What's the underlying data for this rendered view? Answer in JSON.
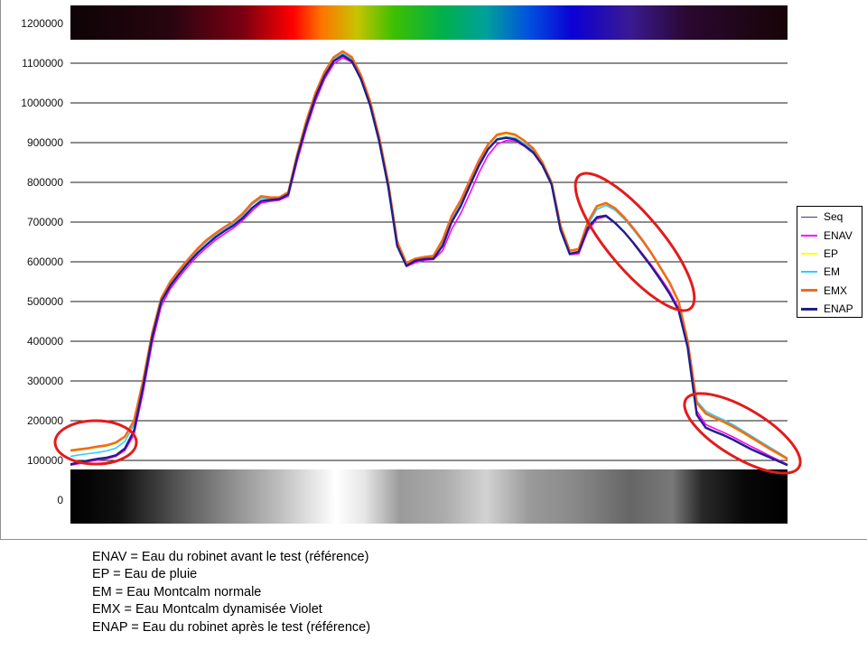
{
  "chart_data": {
    "type": "line",
    "title": "",
    "xlabel": "",
    "ylabel": "",
    "ylim": [
      0,
      1200000
    ],
    "yticks": [
      "0",
      "100000",
      "200000",
      "300000",
      "400000",
      "500000",
      "600000",
      "700000",
      "800000",
      "900000",
      "1000000",
      "1100000",
      "1200000"
    ],
    "grid": true,
    "legend": "right",
    "series": [
      {
        "name": "Seq",
        "color": "#3b3b8f",
        "values": [
          92000,
          96000,
          101000,
          105000,
          108000,
          114000,
          132000,
          178000,
          290000,
          412000,
          502000,
          542000,
          572000,
          600000,
          624000,
          645000,
          664000,
          680000,
          694000,
          713000,
          737000,
          754000,
          757000,
          759000,
          772000,
          868000,
          948000,
          1017000,
          1070000,
          1107000,
          1121000,
          1106000,
          1062000,
          997000,
          908000,
          793000,
          645000,
          592000,
          604000,
          608000,
          609000,
          642000,
          702000,
          742000,
          794000,
          844000,
          885000,
          910000,
          914000,
          910000,
          895000,
          877000,
          845000,
          797000,
          683000,
          622000,
          627000,
          688000,
          714000,
          718000,
          700000,
          677000,
          650000,
          620000,
          590000,
          557000,
          522000,
          480000,
          390000,
          218000,
          184000,
          174000,
          165000,
          154000,
          142000,
          130000,
          120000,
          110000,
          100000,
          90000
        ]
      },
      {
        "name": "ENAV",
        "color": "#ff00ff",
        "values": [
          88000,
          92000,
          97000,
          101000,
          104000,
          110000,
          125000,
          165000,
          270000,
          395000,
          488000,
          532000,
          562000,
          590000,
          615000,
          636000,
          655000,
          671000,
          686000,
          705000,
          728000,
          748000,
          752000,
          755000,
          765000,
          855000,
          935000,
          1005000,
          1060000,
          1098000,
          1114000,
          1102000,
          1062000,
          1000000,
          912000,
          800000,
          655000,
          588000,
          598000,
          604000,
          606000,
          628000,
          682000,
          722000,
          772000,
          824000,
          868000,
          896000,
          905000,
          904000,
          891000,
          873000,
          842000,
          796000,
          684000,
          618000,
          620000,
          678000,
          708000,
          714000,
          697000,
          676000,
          650000,
          621000,
          592000,
          560000,
          526000,
          484000,
          395000,
          225000,
          190000,
          180000,
          170000,
          159000,
          147000,
          135000,
          124000,
          112000,
          101000,
          90000
        ]
      },
      {
        "name": "EP",
        "color": "#ffff00",
        "values": [
          123000,
          126000,
          129000,
          133000,
          136000,
          143000,
          158000,
          197000,
          297000,
          417000,
          506000,
          548000,
          578000,
          605000,
          631000,
          653000,
          670000,
          686000,
          700000,
          720000,
          746000,
          763000,
          760000,
          760000,
          773000,
          870000,
          952000,
          1022000,
          1076000,
          1113000,
          1128000,
          1113000,
          1068000,
          1003000,
          913000,
          798000,
          648000,
          595000,
          606000,
          610000,
          613000,
          652000,
          712000,
          752000,
          802000,
          852000,
          892000,
          917000,
          922000,
          917000,
          903000,
          883000,
          848000,
          798000,
          688000,
          626000,
          630000,
          697000,
          737000,
          745000,
          733000,
          710000,
          683000,
          653000,
          620000,
          583000,
          546000,
          498000,
          398000,
          243000,
          216000,
          205000,
          195000,
          183000,
          170000,
          156000,
          142000,
          128000,
          115000,
          102000
        ]
      },
      {
        "name": "EM",
        "color": "#33ccff",
        "values": [
          110000,
          114000,
          117000,
          120000,
          124000,
          131000,
          148000,
          190000,
          292000,
          414000,
          504000,
          546000,
          576000,
          603000,
          629000,
          651000,
          668000,
          684000,
          698000,
          718000,
          744000,
          760000,
          758000,
          758000,
          770000,
          866000,
          948000,
          1018000,
          1072000,
          1110000,
          1124000,
          1110000,
          1066000,
          1002000,
          912000,
          798000,
          650000,
          594000,
          604000,
          609000,
          611000,
          648000,
          706000,
          746000,
          796000,
          846000,
          886000,
          910000,
          915000,
          912000,
          898000,
          879000,
          846000,
          798000,
          688000,
          622000,
          626000,
          692000,
          732000,
          742000,
          730000,
          708000,
          681000,
          652000,
          620000,
          584000,
          548000,
          502000,
          405000,
          250000,
          224000,
          212000,
          202000,
          190000,
          176000,
          162000,
          148000,
          134000,
          120000,
          106000
        ]
      },
      {
        "name": "EMX",
        "color": "#f26a1b",
        "values": [
          125000,
          128000,
          131000,
          135000,
          138000,
          145000,
          160000,
          200000,
          300000,
          420000,
          508000,
          550000,
          580000,
          607000,
          633000,
          655000,
          672000,
          688000,
          702000,
          722000,
          748000,
          765000,
          762000,
          762000,
          775000,
          872000,
          955000,
          1025000,
          1078000,
          1115000,
          1130000,
          1115000,
          1070000,
          1005000,
          915000,
          800000,
          650000,
          597000,
          608000,
          612000,
          615000,
          655000,
          715000,
          755000,
          805000,
          855000,
          895000,
          920000,
          925000,
          920000,
          905000,
          885000,
          850000,
          800000,
          690000,
          628000,
          632000,
          700000,
          740000,
          748000,
          735000,
          712000,
          685000,
          655000,
          622000,
          585000,
          548000,
          500000,
          400000,
          245000,
          218000,
          207000,
          197000,
          185000,
          172000,
          158000,
          144000,
          130000,
          117000,
          104000
        ]
      },
      {
        "name": "ENAP",
        "color": "#1f1f8c",
        "values": [
          90000,
          95000,
          100000,
          104000,
          107000,
          113000,
          130000,
          175000,
          285000,
          410000,
          500000,
          540000,
          570000,
          598000,
          622000,
          643000,
          662000,
          678000,
          692000,
          711000,
          735000,
          753000,
          756000,
          758000,
          770000,
          865000,
          945000,
          1015000,
          1068000,
          1105000,
          1120000,
          1105000,
          1060000,
          995000,
          905000,
          790000,
          640000,
          590000,
          603000,
          607000,
          608000,
          640000,
          700000,
          740000,
          792000,
          842000,
          883000,
          908000,
          912000,
          908000,
          893000,
          875000,
          843000,
          795000,
          680000,
          620000,
          625000,
          685000,
          712000,
          716000,
          698000,
          675000,
          648000,
          618000,
          588000,
          555000,
          520000,
          478000,
          385000,
          215000,
          182000,
          172000,
          163000,
          152000,
          140000,
          128000,
          118000,
          108000,
          98000,
          88000
        ]
      }
    ]
  },
  "highlight_color": "#e31b1b",
  "notes": [
    "ENAV = Eau du robinet avant le test (référence)",
    "EP = Eau de pluie",
    "EM = Eau Montcalm normale",
    "EMX = Eau Montcalm dynamisée Violet",
    "ENAP = Eau du robinet après le test (référence)"
  ]
}
